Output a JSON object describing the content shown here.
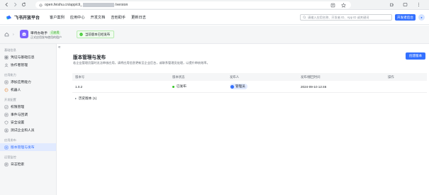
{
  "browser": {
    "url": "open.feishu.cn/app/cli_",
    "url_suffix": "/version"
  },
  "topnav": {
    "logo_text": "飞书开放平台",
    "menu": [
      "客户案例",
      "应用中心",
      "开发文档",
      "吉他助手",
      "更新日志"
    ],
    "search_placeholder": "请输入应用名称、开发者 ID、App ID 或关键词",
    "developer_button": "开发者后台"
  },
  "app": {
    "name": "审待办助手",
    "tag": "已启用",
    "org": "正式应用发布使用的租户",
    "status": "当前版本已经发布"
  },
  "sidebar": {
    "groups": [
      {
        "label": "基础信息",
        "items": [
          "凭证与基础信息",
          "协作者管理"
        ]
      },
      {
        "label": "应用能力",
        "items": [
          "添加应用能力",
          "机器人"
        ]
      },
      {
        "label": "开发配置",
        "items": [
          "权限管理",
          "事件与回调",
          "安全设置",
          "测试企业和人员"
        ]
      },
      {
        "label": "应用发布",
        "items": [
          "版本管理与发布"
        ]
      },
      {
        "label": "运营监控",
        "items": [
          "日志检索"
        ]
      }
    ],
    "active_item": "版本管理与发布"
  },
  "main": {
    "title": "版本管理与发布",
    "description": "若企业管理员暂时无法审核应用，请将应用信息更新至企业后台，或联系管理员处理，以提升审核效率。",
    "create_button": "创建版本",
    "columns": [
      "版本号",
      "版本状态",
      "发布人",
      "发布/撤回时间",
      "操作"
    ],
    "rows": [
      {
        "version": "1.0.2",
        "status": "已发布",
        "publisher": "管理员",
        "time": "2024-09-10 12:46",
        "action": ""
      }
    ],
    "history_label": "历史版本 (1)"
  },
  "colors": {
    "accent": "#3370ff",
    "success": "#34c724",
    "sidebar_bg": "#f5f6f7",
    "active_bg": "#e1eaff"
  }
}
